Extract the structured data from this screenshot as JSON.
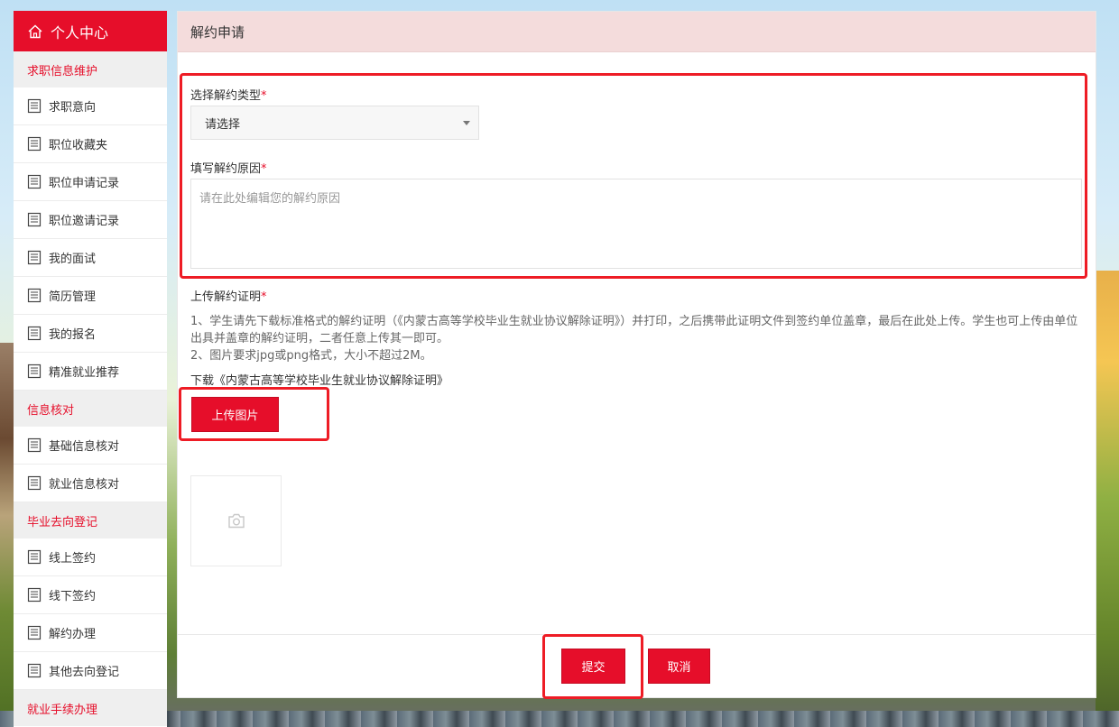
{
  "sidebar": {
    "title": "个人中心",
    "groups": [
      {
        "label": "求职信息维护",
        "items": [
          "求职意向",
          "职位收藏夹",
          "职位申请记录",
          "职位邀请记录",
          "我的面试",
          "简历管理",
          "我的报名",
          "精准就业推荐"
        ]
      },
      {
        "label": "信息核对",
        "items": [
          "基础信息核对",
          "就业信息核对"
        ]
      },
      {
        "label": "毕业去向登记",
        "items": [
          "线上签约",
          "线下签约",
          "解约办理",
          "其他去向登记"
        ]
      },
      {
        "label": "就业手续办理",
        "items": []
      }
    ]
  },
  "main": {
    "title": "解约申请",
    "type_label": "选择解约类型",
    "type_value": "请选择",
    "reason_label": "填写解约原因",
    "reason_placeholder": "请在此处编辑您的解约原因",
    "proof_label": "上传解约证明",
    "required_mark": "*",
    "notice_line1": "1、学生请先下载标准格式的解约证明（《内蒙古高等学校毕业生就业协议解除证明》）并打印，之后携带此证明文件到签约单位盖章，最后在此处上传。学生也可上传由单位出具并盖章的解约证明，二者任意上传其一即可。",
    "notice_line2": "2、图片要求jpg或png格式，大小不超过2M。",
    "download_link": "下载《内蒙古高等学校毕业生就业协议解除证明》",
    "upload_button": "上传图片",
    "submit_button": "提交",
    "cancel_button": "取消"
  },
  "colors": {
    "brand_red": "#e60e2a",
    "header_pink": "#f4dcdc",
    "highlight_red": "#ee1c25"
  },
  "icons": {
    "header": "home-icon",
    "menu_item": "document-icon",
    "photo_placeholder": "camera-icon"
  }
}
